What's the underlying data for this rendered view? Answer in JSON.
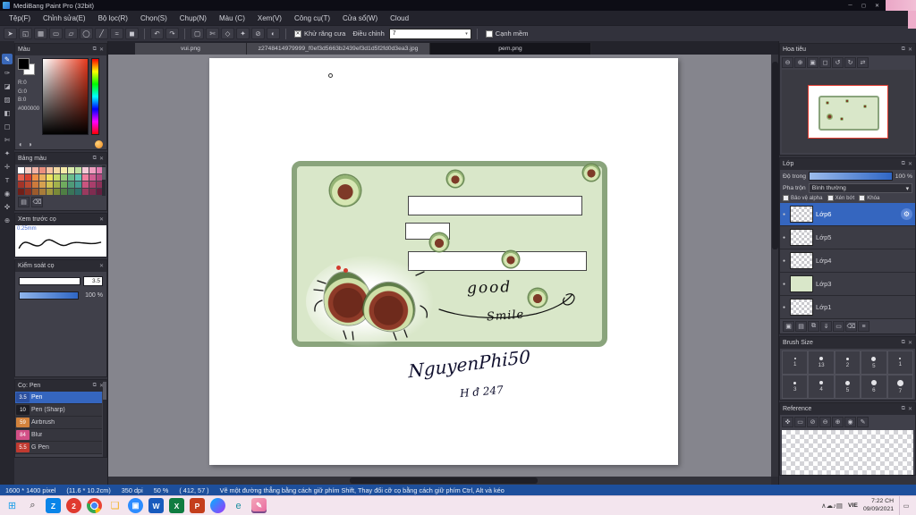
{
  "window": {
    "title": "MediBang Paint Pro (32bit)",
    "minimize_label": "─",
    "maximize_label": "◻",
    "close_label": "✕"
  },
  "menu": {
    "items": [
      "Tệp(F)",
      "Chỉnh sửa(E)",
      "Bộ lọc(R)",
      "Chọn(S)",
      "Chụp(N)",
      "Màu (C)",
      "Xem(V)",
      "Công cụ(T)",
      "Cửa sổ(W)",
      "Cloud"
    ]
  },
  "toolbar": {
    "left_icons": [
      {
        "name": "cursor-icon",
        "glyph": "➤"
      },
      {
        "name": "transform-icon",
        "glyph": "◱"
      },
      {
        "name": "grid-icon",
        "glyph": "▦"
      },
      {
        "name": "ruler-icon",
        "glyph": "▭"
      },
      {
        "name": "shape-rect-icon",
        "glyph": "▱"
      },
      {
        "name": "shape-ellipse-icon",
        "glyph": "◯"
      },
      {
        "name": "line-icon",
        "glyph": "╱"
      },
      {
        "name": "curve-icon",
        "glyph": "≈"
      },
      {
        "name": "fill-shape-icon",
        "glyph": "◼"
      }
    ],
    "history_icons": [
      {
        "name": "undo-icon",
        "glyph": "↶"
      },
      {
        "name": "redo-icon",
        "glyph": "↷"
      }
    ],
    "select_icons": [
      {
        "name": "select-rect-icon",
        "glyph": "▢"
      },
      {
        "name": "select-lasso-icon",
        "glyph": "✄"
      },
      {
        "name": "select-poly-icon",
        "glyph": "◇"
      },
      {
        "name": "magic-wand-icon",
        "glyph": "✦"
      },
      {
        "name": "deselect-icon",
        "glyph": "⊘"
      },
      {
        "name": "invert-selection-icon",
        "glyph": "◐"
      }
    ],
    "antialias_label": "Khử răng cưa",
    "correction_label": "Điều chỉnh",
    "correction_value": "7",
    "soft_edge_label": "Cạnh mềm"
  },
  "tabs": [
    {
      "label": "vui.png",
      "active": false
    },
    {
      "label": "z2748414979999_f0ef3d5663b2439ef3d1d5f2fd0d3ea3.jpg",
      "active": false
    },
    {
      "label": "pem.png",
      "active": true
    }
  ],
  "tools": [
    {
      "name": "pen-tool",
      "glyph": "✎",
      "selected": true
    },
    {
      "name": "brush-tool",
      "glyph": "✑"
    },
    {
      "name": "eraser-tool",
      "glyph": "◪"
    },
    {
      "name": "fill-tool",
      "glyph": "▨"
    },
    {
      "name": "gradient-tool",
      "glyph": "◧"
    },
    {
      "name": "select-tool",
      "glyph": "▢"
    },
    {
      "name": "lasso-tool",
      "glyph": "✄"
    },
    {
      "name": "magic-wand-tool",
      "glyph": "✦"
    },
    {
      "name": "move-tool",
      "glyph": "✛"
    },
    {
      "name": "text-tool",
      "glyph": "T"
    },
    {
      "name": "eyedropper-tool",
      "glyph": "◉"
    },
    {
      "name": "hand-tool",
      "glyph": "✜"
    },
    {
      "name": "zoom-tool",
      "glyph": "⊕"
    }
  ],
  "color_panel": {
    "title": "Màu",
    "r_label": "R:0",
    "g_label": "G:0",
    "b_label": "B:0",
    "hex": "#000000"
  },
  "palette_panel": {
    "title": "Bảng màu",
    "colors": [
      "#ffffff",
      "#f5cfc6",
      "#f2b3a6",
      "#ea8f7e",
      "#f6c2a0",
      "#f3d9a2",
      "#f5eaa8",
      "#dcecae",
      "#bfe0a0",
      "#f6c9d8",
      "#ef9fc0",
      "#e27bb0",
      "#e5604e",
      "#d6402f",
      "#ef8f46",
      "#eab45f",
      "#efe25f",
      "#cadd6b",
      "#9bcd7c",
      "#6cbd8d",
      "#62c6b6",
      "#ef7f9f",
      "#d05e92",
      "#b2487f",
      "#a43428",
      "#bb4a32",
      "#cd7a3c",
      "#d6a150",
      "#cfc253",
      "#a2b14c",
      "#6fab5e",
      "#4f9a78",
      "#459a92",
      "#c9557f",
      "#a93e6b",
      "#8c3158",
      "#6f1f18",
      "#8a3022",
      "#9c5a2c",
      "#a87c3a",
      "#9f953e",
      "#7a8a38",
      "#4f7f44",
      "#3a7458",
      "#306f6a",
      "#9a3a5f",
      "#7f2c50",
      "#641f40"
    ]
  },
  "brush_preview_panel": {
    "title": "Xem trước cọ",
    "size_label": "0.25mm"
  },
  "brush_control_panel": {
    "title": "Kiểm soát cọ",
    "size_value": "3.5",
    "opacity_value": "100 %"
  },
  "brush_list_panel": {
    "title": "Cọ: Pen",
    "brushes": [
      {
        "size": "3.5",
        "name": "Pen",
        "badge_color": "#2b4f9e",
        "selected": true
      },
      {
        "size": "10",
        "name": "Pen (Sharp)",
        "badge_color": "#1d1d24",
        "selected": false
      },
      {
        "size": "59",
        "name": "Airbrush",
        "badge_color": "#d2823c",
        "selected": false
      },
      {
        "size": "84",
        "name": "Blur",
        "badge_color": "#d24f86",
        "selected": false
      },
      {
        "size": "5.5",
        "name": "G Pen",
        "badge_color": "#c03a30",
        "selected": false
      }
    ]
  },
  "navigator_panel": {
    "title": "Hoa tiêu"
  },
  "layers_panel": {
    "title": "Lớp",
    "opacity_label": "Độ trong",
    "opacity_value": "100 %",
    "blend_label": "Pha trộn",
    "blend_value": "Bình thường",
    "checkboxes": [
      "Bảo vệ alpha",
      "Xén bớt",
      "Khóa"
    ],
    "layers": [
      {
        "name": "Lớp6",
        "selected": true
      },
      {
        "name": "Lớp5",
        "selected": false
      },
      {
        "name": "Lớp4",
        "selected": false
      },
      {
        "name": "Lớp3",
        "selected": false,
        "tint": "#d9e7c9"
      },
      {
        "name": "Lớp1",
        "selected": false
      }
    ]
  },
  "brush_size_panel": {
    "title": "Brush Size",
    "cells": [
      {
        "dot": 2,
        "label": "1"
      },
      {
        "dot": 4,
        "label": "13"
      },
      {
        "dot": 3,
        "label": "2"
      },
      {
        "dot": 5,
        "label": "5"
      },
      {
        "dot": 2,
        "label": "1"
      },
      {
        "dot": 3,
        "label": "3"
      },
      {
        "dot": 4,
        "label": "4"
      },
      {
        "dot": 5,
        "label": "5"
      },
      {
        "dot": 6,
        "label": "6"
      },
      {
        "dot": 7,
        "label": "7"
      }
    ]
  },
  "reference_panel": {
    "title": "Reference"
  },
  "icon_rows": {
    "navigator": [
      {
        "name": "zoom-out-icon",
        "glyph": "⊖"
      },
      {
        "name": "zoom-in-icon",
        "glyph": "⊕"
      },
      {
        "name": "fit-view-icon",
        "glyph": "▣"
      },
      {
        "name": "actual-size-icon",
        "glyph": "◻"
      },
      {
        "name": "rotate-left-icon",
        "glyph": "↺"
      },
      {
        "name": "rotate-right-icon",
        "glyph": "↻"
      },
      {
        "name": "reset-view-icon",
        "glyph": "⇄"
      }
    ],
    "layer_toolbar": [
      {
        "name": "add-layer-icon",
        "glyph": "▣"
      },
      {
        "name": "add-folder-icon",
        "glyph": "▤"
      },
      {
        "name": "duplicate-layer-icon",
        "glyph": "⧉"
      },
      {
        "name": "merge-down-icon",
        "glyph": "⇓"
      },
      {
        "name": "clear-layer-icon",
        "glyph": "▭"
      },
      {
        "name": "delete-layer-icon",
        "glyph": "⌫"
      },
      {
        "name": "layer-menu-icon",
        "glyph": "≡"
      }
    ],
    "reference": [
      {
        "name": "hand-icon",
        "glyph": "✜"
      },
      {
        "name": "frame-icon",
        "glyph": "▭"
      },
      {
        "name": "disable-icon",
        "glyph": "⊘"
      },
      {
        "name": "zoom-out-icon",
        "glyph": "⊖"
      },
      {
        "name": "zoom-in-icon",
        "glyph": "⊕"
      },
      {
        "name": "eyedropper-icon",
        "glyph": "◉"
      },
      {
        "name": "edit-icon",
        "glyph": "✎"
      }
    ],
    "palette": [
      {
        "name": "palette-list-icon",
        "glyph": "▤"
      },
      {
        "name": "palette-delete-icon",
        "glyph": "⌫"
      }
    ]
  },
  "canvas": {
    "good_text": "good",
    "smile_text": "Smile",
    "signature_line1": "NguyenPhi50",
    "signature_line2": "H đ 247"
  },
  "status": {
    "dimensions": "1600 * 1400 pixel",
    "size_cm": "(11.6 * 10.2cm)",
    "dpi": "350 dpi",
    "zoom": "50 %",
    "coords": "( 412, 57 )",
    "hint": "Vẽ một đường thẳng bằng cách giữ phím Shift, Thay đổi cỡ cọ bằng cách giữ phím Ctrl, Alt và kéo"
  },
  "taskbar": {
    "icons": [
      {
        "name": "start-button",
        "glyph": "⊞",
        "fg": "#1d9fe8",
        "plain": true
      },
      {
        "name": "search-icon",
        "glyph": "⌕",
        "fg": "#3a3a3a",
        "plain": true
      },
      {
        "name": "zalo-icon",
        "glyph": "Z",
        "bg": "#0a84e8",
        "fg": "#ffffff"
      },
      {
        "name": "notification-badge-icon",
        "glyph": "2",
        "bg": "#e03a2f",
        "fg": "#ffffff",
        "round": true
      },
      {
        "name": "chrome-icon",
        "glyph": "",
        "bg": "radial-gradient(circle, #4285f4 0 28%, #ffffff 28% 38%, rgba(0,0,0,0) 38%), conic-gradient(#ea4335 0deg 120deg, #fbbc05 120deg 170deg, #34a853 170deg 290deg, #ea4335 290deg 360deg)",
        "round": true
      },
      {
        "name": "file-explorer-icon",
        "glyph": "❏",
        "fg": "#f2b321",
        "plain": true
      },
      {
        "name": "zoom-app-icon",
        "glyph": "▣",
        "bg": "#2d8cff",
        "fg": "#ffffff",
        "round": true
      },
      {
        "name": "word-icon",
        "glyph": "W",
        "bg": "#185abd",
        "fg": "#ffffff"
      },
      {
        "name": "excel-icon",
        "glyph": "X",
        "bg": "#107c41",
        "fg": "#ffffff"
      },
      {
        "name": "powerpoint-icon",
        "glyph": "P",
        "bg": "#c43e1c",
        "fg": "#ffffff"
      },
      {
        "name": "messenger-icon",
        "glyph": "",
        "bg": "linear-gradient(135deg,#00b2ff,#a334fa)",
        "round": true
      },
      {
        "name": "edge-icon",
        "glyph": "e",
        "fg": "#1d8fa0",
        "plain": true
      },
      {
        "name": "medibang-icon",
        "glyph": "✎",
        "bg": "linear-gradient(135deg,#f4a6b8,#e86aa0)",
        "fg": "#ffffff",
        "active": true
      }
    ],
    "tray_icons": [
      {
        "name": "tray-expand-icon",
        "glyph": "∧"
      },
      {
        "name": "cloud-icon",
        "glyph": "☁"
      },
      {
        "name": "volume-icon",
        "glyph": "♪"
      },
      {
        "name": "network-icon",
        "glyph": "▤"
      }
    ],
    "language": "VIE",
    "time": "7:22 CH",
    "date": "09/09/2021"
  }
}
